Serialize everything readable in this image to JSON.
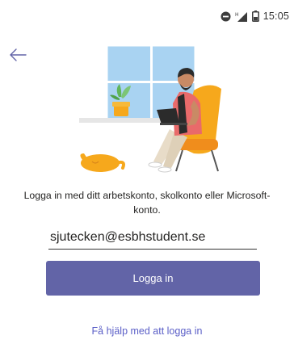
{
  "status_bar": {
    "time": "15:05",
    "icons": [
      "do-not-disturb-icon",
      "signal-icon",
      "battery-icon"
    ]
  },
  "navigation": {
    "back_icon": "arrow-left-icon"
  },
  "illustration": {
    "description_icon": "person-with-laptop-illustration"
  },
  "signin": {
    "prompt": "Logga in med ditt arbetskonto, skolkonto eller Microsoft-konto.",
    "email_value": "sjutecken@esbhstudent.se",
    "button_label": "Logga in",
    "help_link": "Få hjälp med att logga in"
  },
  "colors": {
    "accent": "#6264a7",
    "link": "#5b5fc7",
    "text": "#252423",
    "illustration_window": "#a9d3f2",
    "illustration_chair": "#f6a81c"
  }
}
